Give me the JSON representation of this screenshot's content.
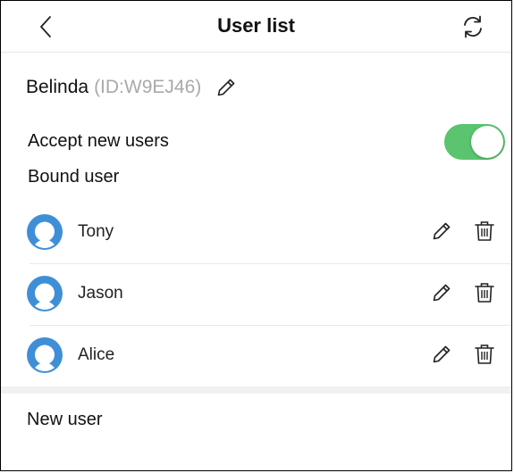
{
  "header": {
    "title": "User list",
    "back_icon": "chevron-left-icon",
    "refresh_icon": "refresh-icon"
  },
  "account": {
    "name": "Belinda",
    "id_text": "(ID:W9EJ46)",
    "edit_icon": "pencil-icon"
  },
  "settings": {
    "accept_label": "Accept new users",
    "accept_enabled": true,
    "toggle_color": "#5ac46e"
  },
  "bound": {
    "label": "Bound user",
    "users": [
      {
        "name": "Tony"
      },
      {
        "name": "Jason"
      },
      {
        "name": "Alice"
      }
    ]
  },
  "new_user": {
    "label": "New user"
  },
  "colors": {
    "avatar": "#3f8fd8",
    "id_gray": "#a9a9a9"
  }
}
